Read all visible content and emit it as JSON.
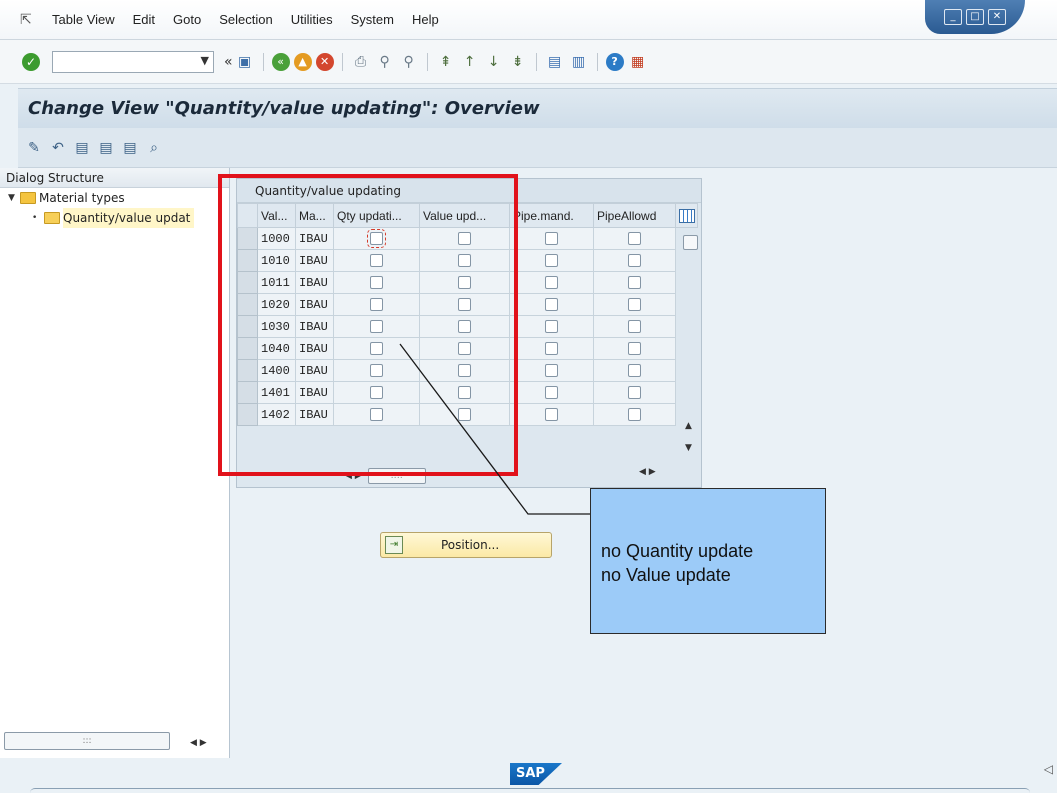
{
  "menubar": {
    "items": [
      {
        "label": "Table View"
      },
      {
        "label": "Edit"
      },
      {
        "label": "Goto"
      },
      {
        "label": "Selection"
      },
      {
        "label": "Utilities"
      },
      {
        "label": "System"
      },
      {
        "label": "Help"
      }
    ]
  },
  "toolbar": {
    "command_value": "",
    "dropdown_glyph": "▼",
    "collapse_glyph": "«"
  },
  "title": "Change View \"Quantity/value updating\": Overview",
  "dialog_structure": {
    "heading": "Dialog Structure",
    "items": [
      {
        "label": "Material types",
        "level": 0,
        "expanded": true
      },
      {
        "label": "Quantity/value updat",
        "level": 1,
        "selected": true
      }
    ]
  },
  "table": {
    "caption": "Quantity/value updating",
    "columns": [
      "Val...",
      "Ma...",
      "Qty updati...",
      "Value upd...",
      "Pipe.mand.",
      "PipeAllowd"
    ],
    "rows": [
      {
        "val": "1000",
        "ma": "IBAU",
        "qty": false,
        "value": false,
        "pipe_mand": false,
        "pipe_allowed": false
      },
      {
        "val": "1010",
        "ma": "IBAU",
        "qty": false,
        "value": false,
        "pipe_mand": false,
        "pipe_allowed": false
      },
      {
        "val": "1011",
        "ma": "IBAU",
        "qty": false,
        "value": false,
        "pipe_mand": false,
        "pipe_allowed": false
      },
      {
        "val": "1020",
        "ma": "IBAU",
        "qty": false,
        "value": false,
        "pipe_mand": false,
        "pipe_allowed": false
      },
      {
        "val": "1030",
        "ma": "IBAU",
        "qty": false,
        "value": false,
        "pipe_mand": false,
        "pipe_allowed": false
      },
      {
        "val": "1040",
        "ma": "IBAU",
        "qty": false,
        "value": false,
        "pipe_mand": false,
        "pipe_allowed": false
      },
      {
        "val": "1400",
        "ma": "IBAU",
        "qty": false,
        "value": false,
        "pipe_mand": false,
        "pipe_allowed": false
      },
      {
        "val": "1401",
        "ma": "IBAU",
        "qty": false,
        "value": false,
        "pipe_mand": false,
        "pipe_allowed": false
      },
      {
        "val": "1402",
        "ma": "IBAU",
        "qty": false,
        "value": false,
        "pipe_mand": false,
        "pipe_allowed": false
      }
    ]
  },
  "position_button": {
    "label": "Position..."
  },
  "callout": {
    "line1": "no Quantity update",
    "line2": "no Value update"
  },
  "footer": {
    "logo": "SAP"
  },
  "colors": {
    "highlight": "#e1121b",
    "callout_bg": "#9ccbf8"
  }
}
